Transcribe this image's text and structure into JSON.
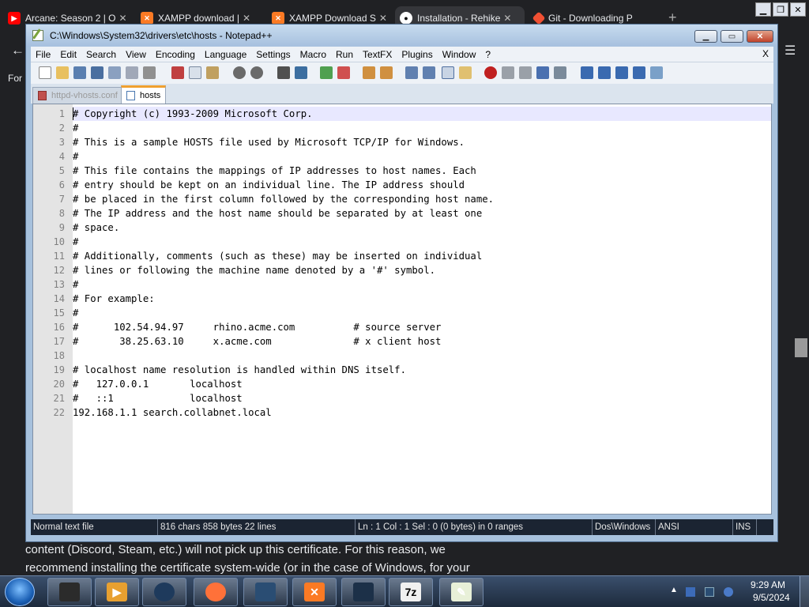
{
  "browser": {
    "tabs": [
      {
        "title": "Arcane: Season 2 | O",
        "icon": "youtube-icon",
        "color": "#ff0000"
      },
      {
        "title": "XAMPP download | ",
        "icon": "xampp-icon",
        "color": "#fb7a24"
      },
      {
        "title": "XAMPP Download S",
        "icon": "xampp-icon",
        "color": "#fb7a24"
      },
      {
        "title": "Installation - Rehike",
        "icon": "github-icon",
        "color": "#ffffff"
      },
      {
        "title": "Git - Downloading P",
        "icon": "git-icon",
        "color": "#f05033"
      }
    ],
    "new_tab_label": "+",
    "side_text": "For",
    "page_text_line1": "content (Discord, Steam, etc.) will not pick up this certificate. For this reason, we",
    "page_text_line2": "recommend installing the certificate system-wide (or in the case of Windows, for your"
  },
  "npp": {
    "title": "C:\\Windows\\System32\\drivers\\etc\\hosts - Notepad++",
    "menu": [
      "File",
      "Edit",
      "Search",
      "View",
      "Encoding",
      "Language",
      "Settings",
      "Macro",
      "Run",
      "TextFX",
      "Plugins",
      "Window",
      "?"
    ],
    "doc_close": "X",
    "tabs": [
      "httpd-vhosts.conf",
      "hosts"
    ],
    "lines": [
      "# Copyright (c) 1993-2009 Microsoft Corp.",
      "#",
      "# This is a sample HOSTS file used by Microsoft TCP/IP for Windows.",
      "#",
      "# This file contains the mappings of IP addresses to host names. Each",
      "# entry should be kept on an individual line. The IP address should",
      "# be placed in the first column followed by the corresponding host name.",
      "# The IP address and the host name should be separated by at least one",
      "# space.",
      "#",
      "# Additionally, comments (such as these) may be inserted on individual",
      "# lines or following the machine name denoted by a '#' symbol.",
      "#",
      "# For example:",
      "#",
      "#      102.54.94.97     rhino.acme.com          # source server",
      "#       38.25.63.10     x.acme.com              # x client host",
      "",
      "# localhost name resolution is handled within DNS itself.",
      "#   127.0.0.1       localhost",
      "#   ::1             localhost",
      "192.168.1.1 search.collabnet.local"
    ],
    "line_numbers": [
      "1",
      "2",
      "3",
      "4",
      "5",
      "6",
      "7",
      "8",
      "9",
      "10",
      "11",
      "12",
      "13",
      "14",
      "15",
      "16",
      "17",
      "18",
      "19",
      "20",
      "21",
      "22"
    ],
    "status": {
      "type": "Normal text file",
      "size": "816 chars   858 bytes   22 lines",
      "pos": "Ln : 1    Col : 1    Sel : 0 (0 bytes) in 0 ranges",
      "eol": "Dos\\Windows",
      "enc": "ANSI",
      "mode": "INS"
    }
  },
  "taskbar": {
    "buttons": [
      {
        "name": "explorer",
        "icon": "folder-icon",
        "color": "#2b2b2b",
        "glyph": ""
      },
      {
        "name": "media-player",
        "icon": "media-player-icon",
        "color": "#e8a030",
        "glyph": "▶"
      },
      {
        "name": "browser-orb",
        "icon": "globe-icon",
        "color": "#1e3a5c",
        "glyph": ""
      },
      {
        "name": "firefox",
        "icon": "firefox-icon",
        "color": "#ff7139",
        "glyph": ""
      },
      {
        "name": "vm",
        "icon": "virtual-machine-icon",
        "color": "#2a4d73",
        "glyph": ""
      },
      {
        "name": "xampp",
        "icon": "xampp-icon",
        "color": "#fb7a24",
        "glyph": "✕"
      },
      {
        "name": "remote",
        "icon": "monitor-icon",
        "color": "#1c3048",
        "glyph": ""
      },
      {
        "name": "7zip",
        "icon": "7zip-icon",
        "color": "#f0f0f0",
        "glyph": "7z"
      },
      {
        "name": "notepadpp",
        "icon": "notepad-plus-plus-icon",
        "color": "#e8f0d8",
        "glyph": "✎"
      }
    ],
    "clock_time": "9:29 AM",
    "clock_date": "9/5/2024"
  }
}
